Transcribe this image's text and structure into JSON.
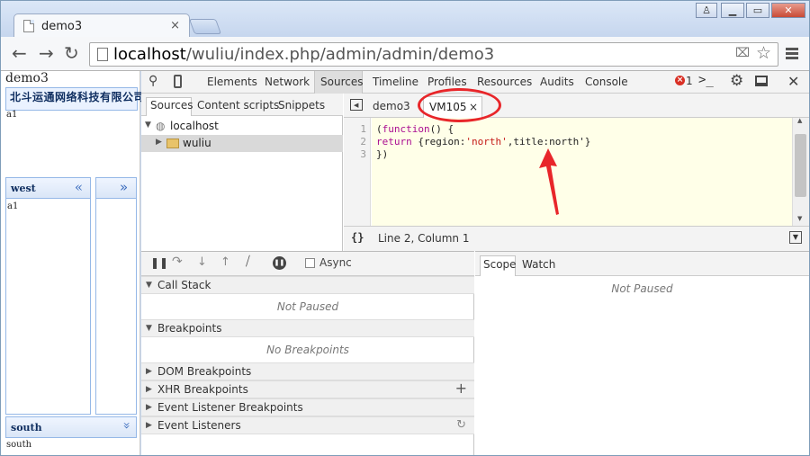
{
  "browser": {
    "tab_title": "demo3",
    "tab_close": "×",
    "url_host": "localhost",
    "url_path": "/wuliu/index.php/admin/admin/demo3",
    "window_buttons": [
      "♙",
      "▁",
      "▭",
      "✕"
    ]
  },
  "page": {
    "title": "demo3",
    "company": "北斗运通网络科技有限公司",
    "north_content": "a1",
    "west_title": "west",
    "west_content": "a1",
    "south_title": "south",
    "south_content": "south"
  },
  "devtools": {
    "tabs": [
      "Elements",
      "Network",
      "Sources",
      "Timeline",
      "Profiles",
      "Resources",
      "Audits",
      "Console"
    ],
    "error_count": "1",
    "navigator_tabs": [
      "Sources",
      "Content scripts",
      "Snippets"
    ],
    "tree": {
      "root": "localhost",
      "folder": "wuliu"
    },
    "editor_tabs": [
      "demo3",
      "VM105"
    ],
    "editor_tab_close": "×",
    "line_numbers": [
      "1",
      "2",
      "3"
    ],
    "code": {
      "line1_a": "(",
      "line1_kw": "function",
      "line1_b": "() {",
      "line2_kw": "return",
      "line2_a": " {region:",
      "line2_str": "'north'",
      "line2_b": ",title:north'}",
      "line3": "})"
    },
    "status_braces": "{}",
    "status_position": "Line 2, Column 1",
    "async_label": "Async",
    "sections": [
      {
        "label": "Call Stack",
        "expanded": true,
        "empty": "Not Paused"
      },
      {
        "label": "Breakpoints",
        "expanded": true,
        "empty": "No Breakpoints"
      },
      {
        "label": "DOM Breakpoints",
        "expanded": false
      },
      {
        "label": "XHR Breakpoints",
        "expanded": false
      },
      {
        "label": "Event Listener Breakpoints",
        "expanded": false
      },
      {
        "label": "Event Listeners",
        "expanded": false
      }
    ],
    "scope_tabs": [
      "Scope",
      "Watch"
    ],
    "scope_empty": "Not Paused"
  },
  "colors": {
    "annotation": "#e8262a",
    "accent": "#0e2d5f"
  }
}
